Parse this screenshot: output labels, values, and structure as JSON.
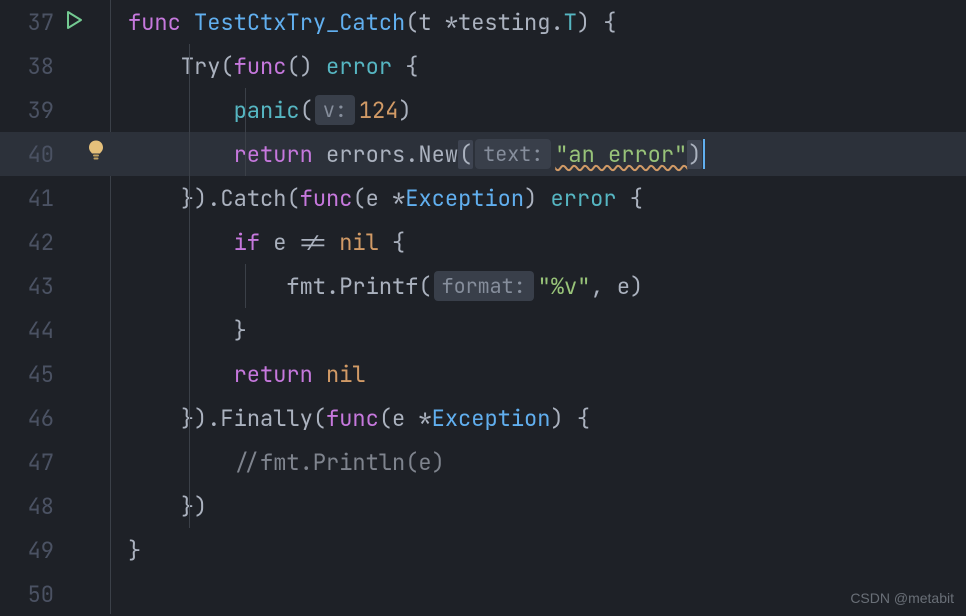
{
  "gutter": {
    "lines": [
      "37",
      "38",
      "39",
      "40",
      "41",
      "42",
      "43",
      "44",
      "45",
      "46",
      "47",
      "48",
      "49",
      "50"
    ],
    "active_index": 3
  },
  "code": {
    "l37": {
      "kw_func": "func",
      "name": "TestCtxTry_Catch",
      "lp": "(",
      "t": "t ",
      "star": "*",
      "pkg": "testing",
      "dot": ".",
      "typeT": "T",
      "rp": ") {"
    },
    "l38": {
      "try": "Try",
      "lp": "(",
      "kw_func": "func",
      "parens": "() ",
      "err_type": "error",
      "brace": " {"
    },
    "l39": {
      "panic": "panic",
      "lp": "(",
      "hint": "v:",
      "num": "124",
      "rp": ")"
    },
    "l40": {
      "ret": "return",
      "sp": " ",
      "errors": "errors",
      "dot": ".",
      "new": "New",
      "lp": "(",
      "hint": "text:",
      "str": "\"an error\"",
      "rp": ")"
    },
    "l41": {
      "close": "}).",
      "catch": "Catch",
      "lp": "(",
      "kw_func": "func",
      "lp2": "(",
      "e": "e ",
      "star": "*",
      "exc": "Exception",
      "rp2": ") ",
      "err_type": "error",
      "brace": " {"
    },
    "l42": {
      "kw_if": "if",
      "sp": " ",
      "e": "e",
      "neq": " != ",
      "nil": "nil",
      "brace": " {"
    },
    "l43": {
      "fmt": "fmt",
      "dot": ".",
      "printf": "Printf",
      "lp": "(",
      "hint": "format:",
      "str": "\"%v\"",
      "comma": ", ",
      "e": "e",
      "rp": ")"
    },
    "l44": {
      "close": "}"
    },
    "l45": {
      "ret": "return",
      "sp": " ",
      "nil": "nil"
    },
    "l46": {
      "close": "}).",
      "finally": "Finally",
      "lp": "(",
      "kw_func": "func",
      "lp2": "(",
      "e": "e ",
      "star": "*",
      "exc": "Exception",
      "rp2": ") {",
      "after": ""
    },
    "l47": {
      "comment": "//fmt.Println(e)"
    },
    "l48": {
      "close": "})"
    },
    "l49": {
      "close": "}"
    }
  },
  "watermark": "CSDN @metabit"
}
